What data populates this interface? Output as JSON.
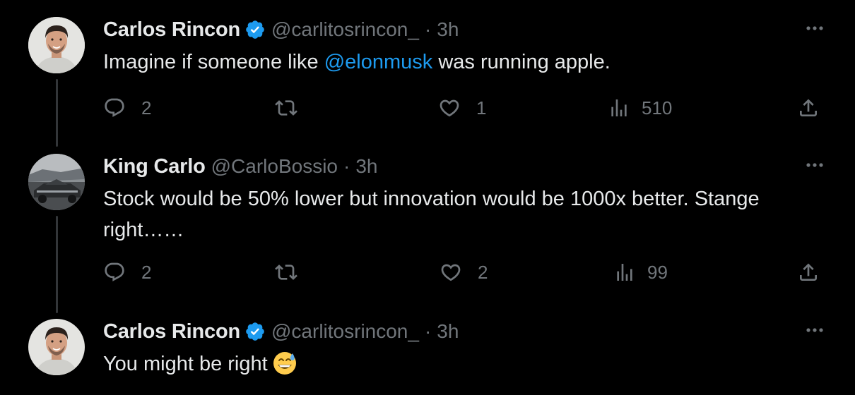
{
  "colors": {
    "background": "#000000",
    "text": "#e7e9ea",
    "secondary": "#71767b",
    "accent": "#1d9bf0",
    "thread_line": "#333639"
  },
  "tweets": [
    {
      "display_name": "Carlos Rincon",
      "verified": true,
      "handle": "@carlitosrincon_",
      "separator": "·",
      "time": "3h",
      "text_parts": [
        {
          "text": "Imagine if someone like ",
          "type": "text"
        },
        {
          "text": "@elonmusk",
          "type": "mention"
        },
        {
          "text": " was running apple.",
          "type": "text"
        }
      ],
      "replies": "2",
      "retweets": "",
      "likes": "1",
      "views": "510",
      "avatar_icon": "profile-photo-man"
    },
    {
      "display_name": "King Carlo",
      "verified": false,
      "handle": "@CarloBossio",
      "separator": "·",
      "time": "3h",
      "text_parts": [
        {
          "text": "Stock would be 50% lower but innovation would be 1000x better. Stange right……",
          "type": "text"
        }
      ],
      "replies": "2",
      "retweets": "",
      "likes": "2",
      "views": "99",
      "avatar_icon": "profile-photo-vehicle"
    },
    {
      "display_name": "Carlos Rincon",
      "verified": true,
      "handle": "@carlitosrincon_",
      "separator": "·",
      "time": "3h",
      "text_parts": [
        {
          "text": "You might be right",
          "type": "text"
        }
      ],
      "emoji": "grinning-face-with-sweat",
      "avatar_icon": "profile-photo-man"
    }
  ]
}
